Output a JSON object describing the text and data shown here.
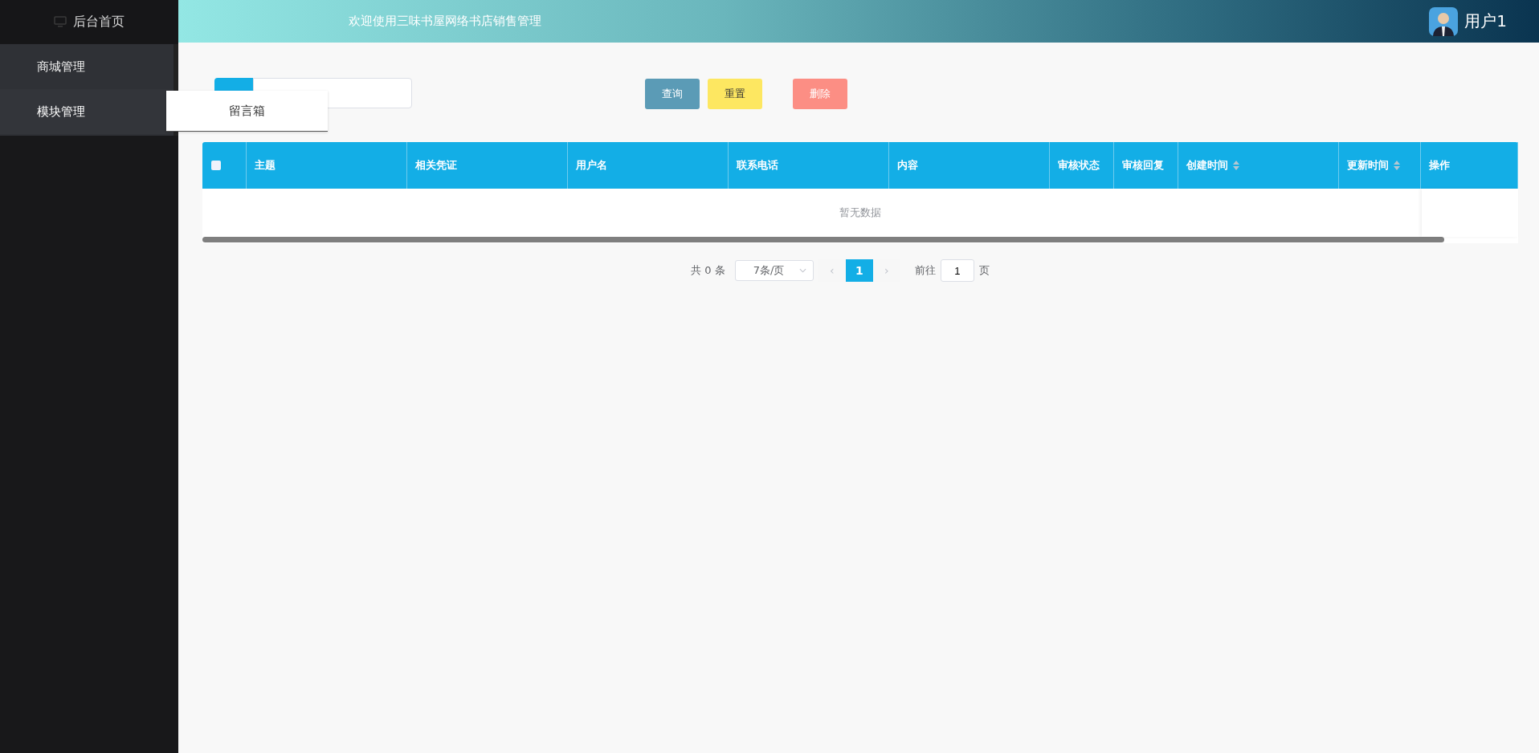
{
  "sidebar": {
    "home": {
      "label": "后台首页"
    },
    "items": [
      {
        "label": "商城管理",
        "selected": false
      },
      {
        "label": "模块管理",
        "selected": true
      }
    ],
    "flyout": {
      "items": [
        {
          "label": "留言箱"
        }
      ]
    }
  },
  "header": {
    "title": "欢迎使用三味书屋网络书店销售管理",
    "user": "用户1"
  },
  "toolbar": {
    "buttons": [
      {
        "label": "查询",
        "kind": "query"
      },
      {
        "label": "重置",
        "kind": "reset"
      },
      {
        "label": "删除",
        "kind": "delete"
      }
    ]
  },
  "table": {
    "select_all": {
      "checked": false
    },
    "columns": [
      {
        "label": "主题",
        "sortable": false
      },
      {
        "label": "相关凭证",
        "sortable": false
      },
      {
        "label": "用户名",
        "sortable": false
      },
      {
        "label": "联系电话",
        "sortable": false
      },
      {
        "label": "内容",
        "sortable": false
      },
      {
        "label": "审核状态",
        "sortable": false
      },
      {
        "label": "审核回复",
        "sortable": false
      },
      {
        "label": "创建时间",
        "sortable": true
      },
      {
        "label": "更新时间",
        "sortable": true
      },
      {
        "label": "操作",
        "sortable": false
      }
    ],
    "empty_text": "暂无数据"
  },
  "pagination": {
    "total": "共 0 条",
    "page_size": "7条/页",
    "prev": "‹",
    "pages": [
      {
        "label": "1",
        "selected": true
      }
    ],
    "next": "›",
    "goto_label": "前往",
    "goto_value": "1",
    "goto_suffix": "页"
  }
}
